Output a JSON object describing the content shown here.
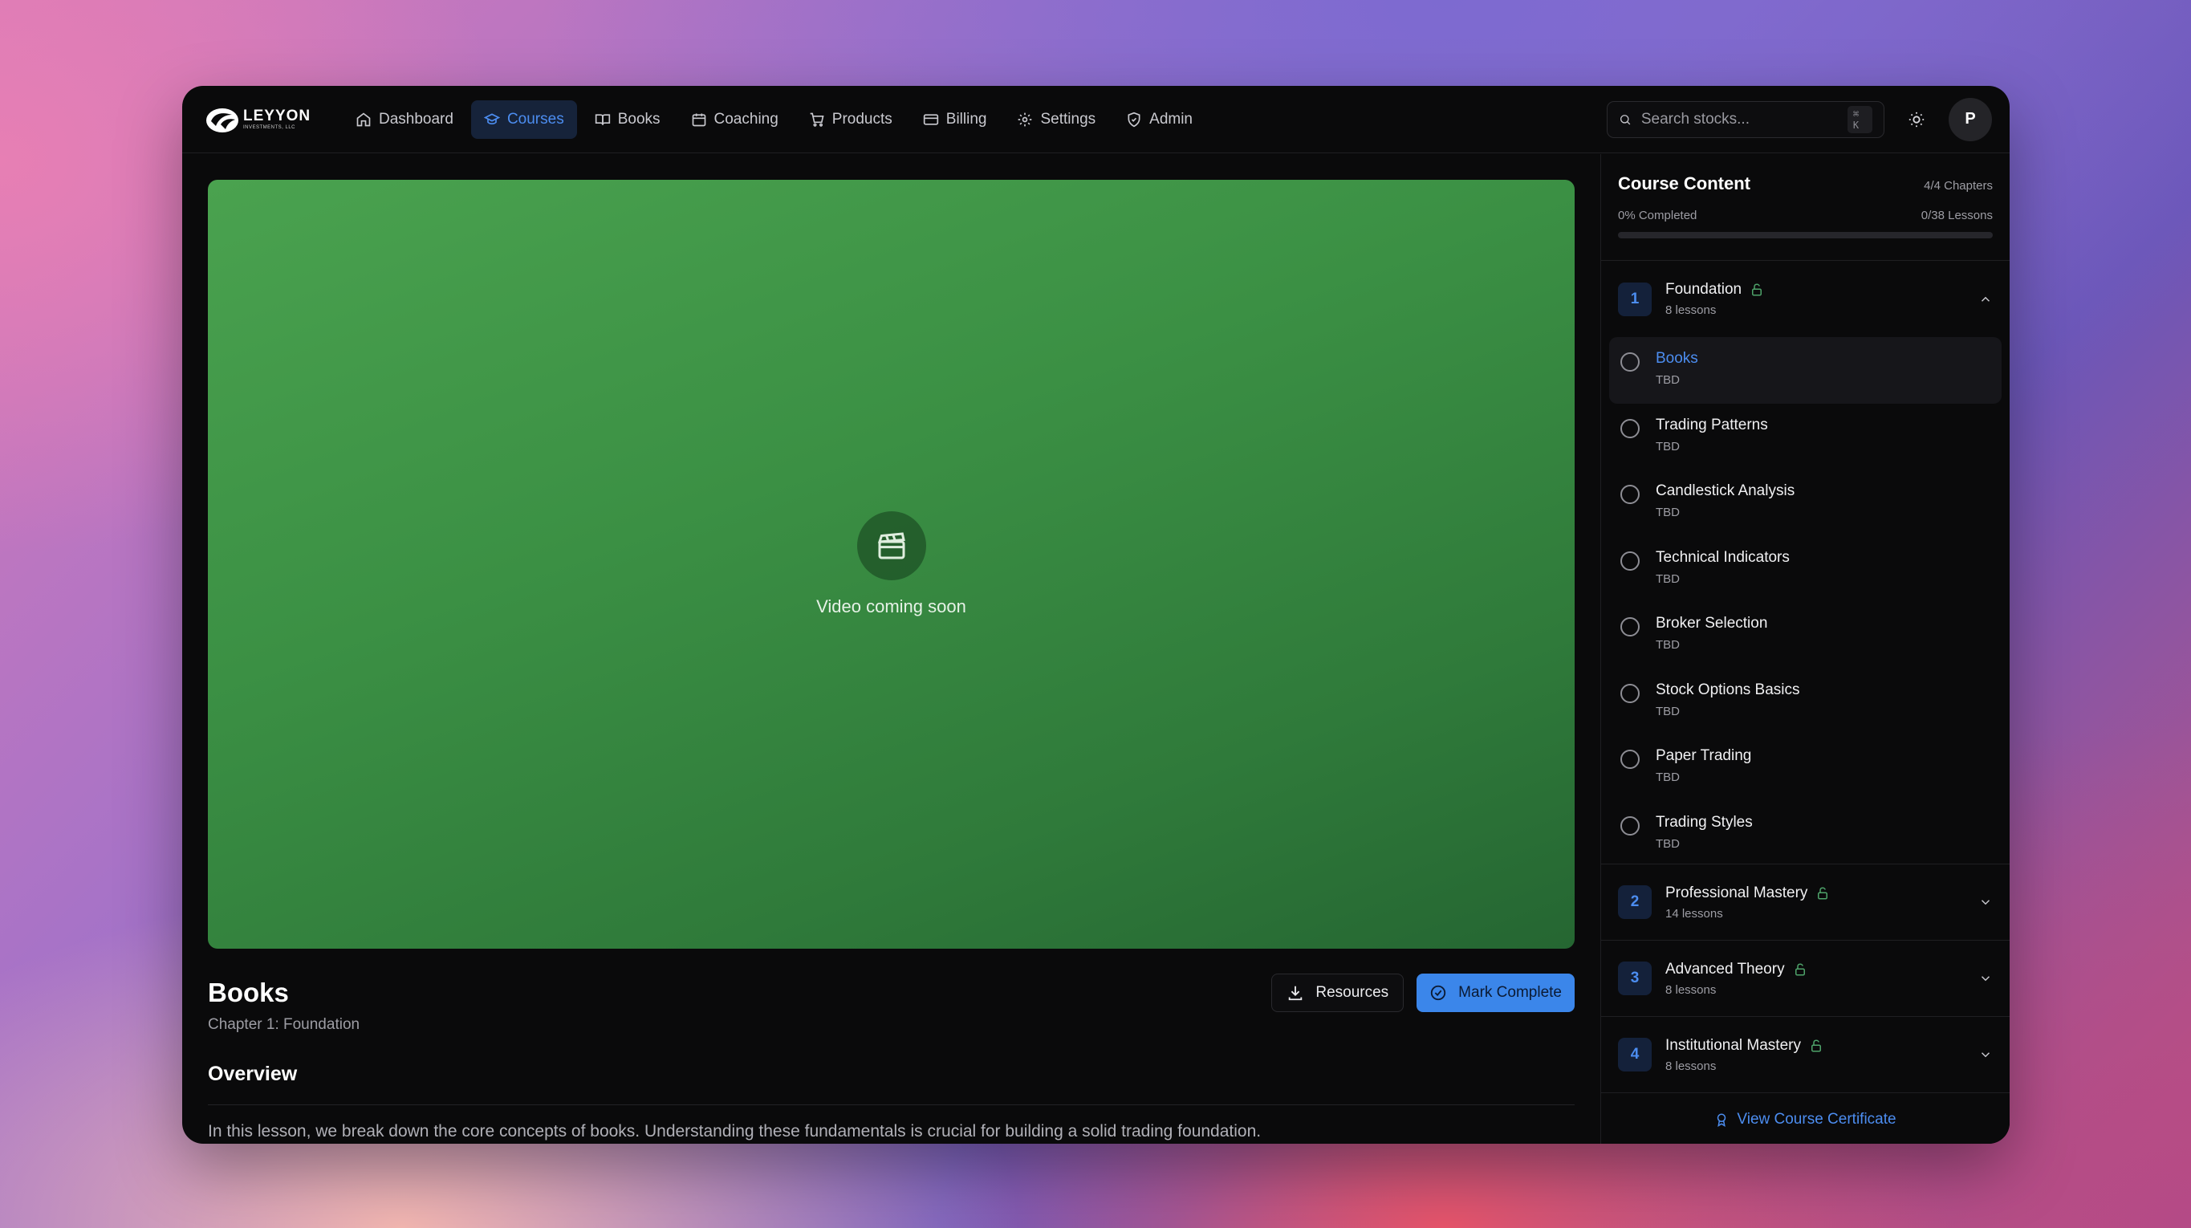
{
  "brand": {
    "name": "LEYYON",
    "sub": "INVESTMENTS, LLC"
  },
  "nav": {
    "items": [
      {
        "label": "Dashboard",
        "icon": "home-icon",
        "active": false
      },
      {
        "label": "Courses",
        "icon": "graduation-cap-icon",
        "active": true
      },
      {
        "label": "Books",
        "icon": "book-open-icon",
        "active": false
      },
      {
        "label": "Coaching",
        "icon": "calendar-icon",
        "active": false
      },
      {
        "label": "Products",
        "icon": "cart-icon",
        "active": false
      },
      {
        "label": "Billing",
        "icon": "credit-card-icon",
        "active": false
      },
      {
        "label": "Settings",
        "icon": "gear-icon",
        "active": false
      },
      {
        "label": "Admin",
        "icon": "shield-icon",
        "active": false
      }
    ]
  },
  "search": {
    "placeholder": "Search stocks...",
    "shortcut": "⌘ K"
  },
  "user": {
    "initial": "P"
  },
  "video": {
    "placeholder_text": "Video coming soon",
    "icon": "clapperboard-icon"
  },
  "lesson": {
    "title": "Books",
    "chapter_label": "Chapter 1: Foundation",
    "resources_label": "Resources",
    "complete_label": "Mark Complete",
    "overview_heading": "Overview",
    "overview_text": "In this lesson, we break down the core concepts of books. Understanding these fundamentals is crucial for building a solid trading foundation."
  },
  "sidebar": {
    "title": "Course Content",
    "chapters_count": "4/4 Chapters",
    "completed": "0% Completed",
    "lessons_count": "0/38 Lessons",
    "progress_fraction": 0,
    "chapters": [
      {
        "number": "1",
        "name": "Foundation",
        "count": "8 lessons",
        "expanded": true,
        "lessons": [
          {
            "name": "Books",
            "duration": "TBD",
            "active": true
          },
          {
            "name": "Trading Patterns",
            "duration": "TBD",
            "active": false
          },
          {
            "name": "Candlestick Analysis",
            "duration": "TBD",
            "active": false
          },
          {
            "name": "Technical Indicators",
            "duration": "TBD",
            "active": false
          },
          {
            "name": "Broker Selection",
            "duration": "TBD",
            "active": false
          },
          {
            "name": "Stock Options Basics",
            "duration": "TBD",
            "active": false
          },
          {
            "name": "Paper Trading",
            "duration": "TBD",
            "active": false
          },
          {
            "name": "Trading Styles",
            "duration": "TBD",
            "active": false
          }
        ]
      },
      {
        "number": "2",
        "name": "Professional Mastery",
        "count": "14 lessons",
        "expanded": false
      },
      {
        "number": "3",
        "name": "Advanced Theory",
        "count": "8 lessons",
        "expanded": false
      },
      {
        "number": "4",
        "name": "Institutional Mastery",
        "count": "8 lessons",
        "expanded": false
      }
    ],
    "certificate_label": "View Course Certificate"
  },
  "colors": {
    "accent": "#3b86ea",
    "accent_text": "#4c8df0",
    "lock_icon": "#4ea36a",
    "video_bg": "#3b9044"
  }
}
